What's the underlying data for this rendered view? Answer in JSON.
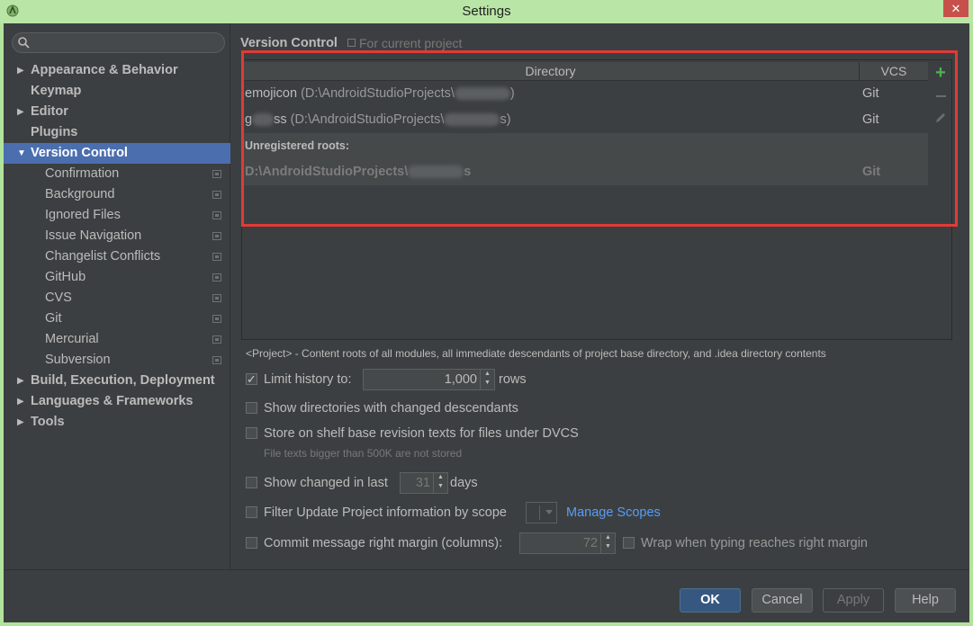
{
  "window": {
    "title": "Settings"
  },
  "sidebar": {
    "search_placeholder": "",
    "items": [
      {
        "label": "Appearance & Behavior",
        "expandable": true,
        "bold": true
      },
      {
        "label": "Keymap",
        "bold": true
      },
      {
        "label": "Editor",
        "expandable": true,
        "bold": true
      },
      {
        "label": "Plugins",
        "bold": true
      },
      {
        "label": "Version Control",
        "expanded": true,
        "bold": true,
        "selected": true
      },
      {
        "label": "Confirmation",
        "project_icon": true
      },
      {
        "label": "Background",
        "project_icon": true
      },
      {
        "label": "Ignored Files",
        "project_icon": true
      },
      {
        "label": "Issue Navigation",
        "project_icon": true
      },
      {
        "label": "Changelist Conflicts",
        "project_icon": true
      },
      {
        "label": "GitHub",
        "project_icon": true
      },
      {
        "label": "CVS",
        "project_icon": true
      },
      {
        "label": "Git",
        "project_icon": true
      },
      {
        "label": "Mercurial",
        "project_icon": true
      },
      {
        "label": "Subversion",
        "project_icon": true
      },
      {
        "label": "Build, Execution, Deployment",
        "expandable": true,
        "bold": true
      },
      {
        "label": "Languages & Frameworks",
        "expandable": true,
        "bold": true
      },
      {
        "label": "Tools",
        "expandable": true,
        "bold": true
      }
    ]
  },
  "main": {
    "title": "Version Control",
    "title_note": "For current project",
    "table": {
      "col_directory": "Directory",
      "col_vcs": "VCS",
      "rows": [
        {
          "name": "emojicon",
          "path_prefix": "(D:\\AndroidStudioProjects\\",
          "path_suffix": ")",
          "vcs": "Git"
        },
        {
          "name_start": "g",
          "name_end": "ss",
          "path_prefix": "(D:\\AndroidStudioProjects\\",
          "path_suffix": "s)",
          "vcs": "Git"
        }
      ],
      "unregistered_title": "Unregistered roots:",
      "unregistered_row": {
        "path_prefix": "D:\\AndroidStudioProjects\\",
        "path_suffix": "s",
        "vcs": "Git"
      }
    },
    "description": "<Project> - Content roots of all modules, all immediate descendants of project base directory, and .idea directory contents",
    "options": {
      "limit_history_label": "Limit history to:",
      "limit_history_value": "1,000",
      "limit_history_unit": "rows",
      "limit_history_checked": true,
      "show_dirs_label": "Show directories with changed descendants",
      "store_shelf_label": "Store on shelf base revision texts for files under DVCS",
      "store_shelf_hint": "File texts bigger than 500K are not stored",
      "show_changed_label": "Show changed in last",
      "show_changed_value": "31",
      "show_changed_unit": "days",
      "filter_update_label": "Filter Update Project information by scope",
      "manage_scopes_link": "Manage Scopes",
      "commit_margin_label": "Commit message right margin (columns):",
      "commit_margin_value": "72",
      "wrap_label": "Wrap when typing reaches right margin"
    }
  },
  "footer": {
    "ok": "OK",
    "cancel": "Cancel",
    "apply": "Apply",
    "help": "Help"
  },
  "colors": {
    "selection": "#4b6eaf",
    "highlight_border": "#e23a34",
    "add_icon": "#4fb24f",
    "link": "#589df6"
  }
}
